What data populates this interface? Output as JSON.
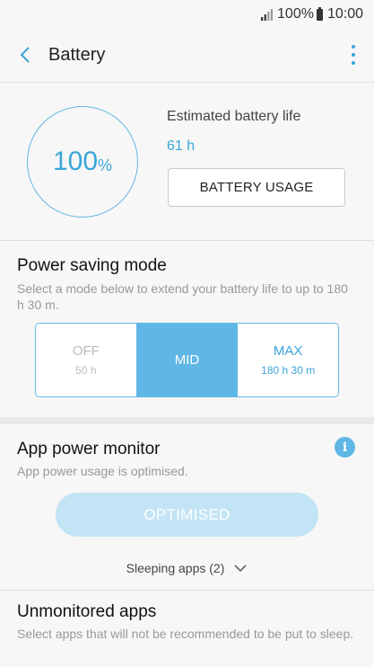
{
  "status_bar": {
    "battery_percent": "100%",
    "time": "10:00",
    "signal_icon": "signal-icon",
    "battery_icon": "battery-icon"
  },
  "app_bar": {
    "title": "Battery",
    "back_icon": "back-arrow-icon",
    "more_icon": "more-vertical-icon"
  },
  "battery": {
    "level_number": "100",
    "level_unit": "%",
    "estimate_label": "Estimated battery life",
    "estimate_value": "61 h",
    "usage_button": "BATTERY USAGE"
  },
  "power_saving": {
    "title": "Power saving mode",
    "description": "Select a mode below to extend your battery life to up to 180 h 30 m.",
    "modes": [
      {
        "label": "OFF",
        "value": "50 h",
        "state": "disabled"
      },
      {
        "label": "MID",
        "value": "",
        "state": "selected"
      },
      {
        "label": "MAX",
        "value": "180 h 30 m",
        "state": "available"
      }
    ]
  },
  "app_power_monitor": {
    "title": "App power monitor",
    "subtitle": "App power usage is optimised.",
    "info_icon": "info-icon",
    "info_glyph": "i",
    "button_label": "OPTIMISED",
    "sleeping_apps": "Sleeping apps (2)",
    "expand_icon": "chevron-down-icon"
  },
  "unmonitored": {
    "title": "Unmonitored apps",
    "description": "Select apps that will not be recommended to be put to sleep."
  },
  "colors": {
    "accent": "#3aa5d9",
    "selected_mode": "#5fb7e5",
    "disabled_button": "#c3e4f5"
  }
}
